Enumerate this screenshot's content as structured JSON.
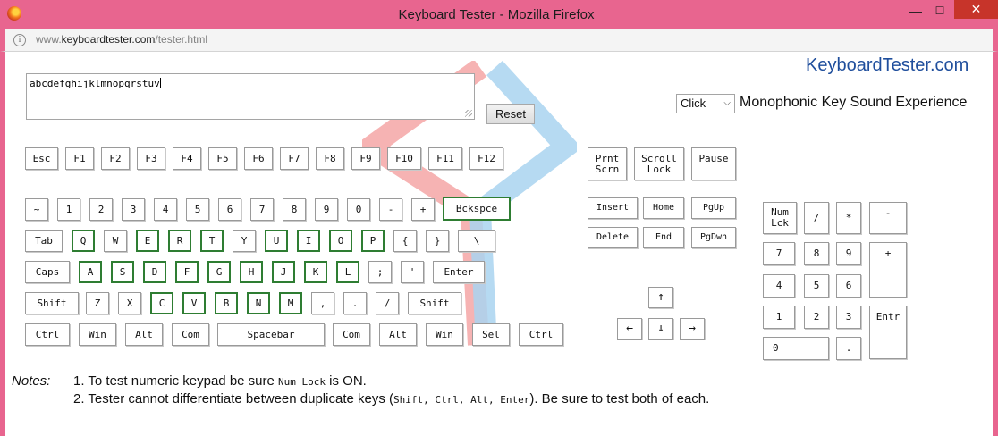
{
  "window": {
    "title": "Keyboard Tester - Mozilla Firefox",
    "minimize_glyph": "—",
    "maximize_glyph": "☐",
    "close_glyph": "✕"
  },
  "address_bar": {
    "info_glyph": "i",
    "url_prefix": "www.",
    "url_host": "keyboardtester.com",
    "url_path": "/tester.html"
  },
  "page": {
    "logo_text": "KeyboardTester.com",
    "typed_text": "abcdefghijklmnopqrstuv",
    "reset_label": "Reset",
    "sound_select_value": "Click",
    "sound_select_arrow": "⌵",
    "sound_label": "Monophonic Key Sound Experience"
  },
  "keys": {
    "fn_row": [
      {
        "label": "Esc",
        "pressed": false
      },
      {
        "label": "F1",
        "pressed": false
      },
      {
        "label": "F2",
        "pressed": false
      },
      {
        "label": "F3",
        "pressed": false
      },
      {
        "label": "F4",
        "pressed": false
      },
      {
        "label": "F5",
        "pressed": false
      },
      {
        "label": "F6",
        "pressed": false
      },
      {
        "label": "F7",
        "pressed": false
      },
      {
        "label": "F8",
        "pressed": false
      },
      {
        "label": "F9",
        "pressed": false
      },
      {
        "label": "F10",
        "pressed": false
      },
      {
        "label": "F11",
        "pressed": false
      },
      {
        "label": "F12",
        "pressed": false
      }
    ],
    "num_row": [
      {
        "label": "~",
        "pressed": false
      },
      {
        "label": "1",
        "pressed": false
      },
      {
        "label": "2",
        "pressed": false
      },
      {
        "label": "3",
        "pressed": false
      },
      {
        "label": "4",
        "pressed": false
      },
      {
        "label": "5",
        "pressed": false
      },
      {
        "label": "6",
        "pressed": false
      },
      {
        "label": "7",
        "pressed": false
      },
      {
        "label": "8",
        "pressed": false
      },
      {
        "label": "9",
        "pressed": false
      },
      {
        "label": "0",
        "pressed": false
      },
      {
        "label": "-",
        "pressed": false
      },
      {
        "label": "+",
        "pressed": false
      },
      {
        "label": "Bckspce",
        "pressed": true
      }
    ],
    "tab_row": [
      {
        "label": "Tab",
        "pressed": false
      },
      {
        "label": "Q",
        "pressed": true
      },
      {
        "label": "W",
        "pressed": false
      },
      {
        "label": "E",
        "pressed": true
      },
      {
        "label": "R",
        "pressed": true
      },
      {
        "label": "T",
        "pressed": true
      },
      {
        "label": "Y",
        "pressed": false
      },
      {
        "label": "U",
        "pressed": true
      },
      {
        "label": "I",
        "pressed": true
      },
      {
        "label": "O",
        "pressed": true
      },
      {
        "label": "P",
        "pressed": true
      },
      {
        "label": "{",
        "pressed": false
      },
      {
        "label": "}",
        "pressed": false
      },
      {
        "label": "\\",
        "pressed": false
      }
    ],
    "caps_row": [
      {
        "label": "Caps",
        "pressed": false
      },
      {
        "label": "A",
        "pressed": true
      },
      {
        "label": "S",
        "pressed": true
      },
      {
        "label": "D",
        "pressed": true
      },
      {
        "label": "F",
        "pressed": true
      },
      {
        "label": "G",
        "pressed": true
      },
      {
        "label": "H",
        "pressed": true
      },
      {
        "label": "J",
        "pressed": true
      },
      {
        "label": "K",
        "pressed": true
      },
      {
        "label": "L",
        "pressed": true
      },
      {
        "label": ";",
        "pressed": false
      },
      {
        "label": "'",
        "pressed": false
      },
      {
        "label": "Enter",
        "pressed": false
      }
    ],
    "shift_row": [
      {
        "label": "Shift",
        "pressed": false
      },
      {
        "label": "Z",
        "pressed": false
      },
      {
        "label": "X",
        "pressed": false
      },
      {
        "label": "C",
        "pressed": true
      },
      {
        "label": "V",
        "pressed": true
      },
      {
        "label": "B",
        "pressed": true
      },
      {
        "label": "N",
        "pressed": true
      },
      {
        "label": "M",
        "pressed": true
      },
      {
        "label": ",",
        "pressed": false
      },
      {
        "label": ".",
        "pressed": false
      },
      {
        "label": "/",
        "pressed": false
      },
      {
        "label": "Shift",
        "pressed": false
      }
    ],
    "bottom_row": [
      {
        "label": "Ctrl",
        "pressed": false
      },
      {
        "label": "Win",
        "pressed": false
      },
      {
        "label": "Alt",
        "pressed": false
      },
      {
        "label": "Com",
        "pressed": false
      },
      {
        "label": "Spacebar",
        "pressed": false
      },
      {
        "label": "Com",
        "pressed": false
      },
      {
        "label": "Alt",
        "pressed": false
      },
      {
        "label": "Win",
        "pressed": false
      },
      {
        "label": "Sel",
        "pressed": false
      },
      {
        "label": "Ctrl",
        "pressed": false
      }
    ],
    "system_keys": [
      {
        "label": "Prnt Scrn",
        "pressed": false
      },
      {
        "label": "Scroll Lock",
        "pressed": false
      },
      {
        "label": "Pause",
        "pressed": false
      }
    ],
    "nav_keys": [
      {
        "label": "Insert",
        "pressed": false
      },
      {
        "label": "Home",
        "pressed": false
      },
      {
        "label": "PgUp",
        "pressed": false
      },
      {
        "label": "Delete",
        "pressed": false
      },
      {
        "label": "End",
        "pressed": false
      },
      {
        "label": "PgDwn",
        "pressed": false
      }
    ],
    "arrow_keys": [
      {
        "label": "↑",
        "pressed": false
      },
      {
        "label": "←",
        "pressed": false
      },
      {
        "label": "↓",
        "pressed": false
      },
      {
        "label": "→",
        "pressed": false
      }
    ],
    "numpad": [
      {
        "label": "Num Lck",
        "pressed": false
      },
      {
        "label": "/",
        "pressed": false
      },
      {
        "label": "*",
        "pressed": false
      },
      {
        "label": "-",
        "pressed": false
      },
      {
        "label": "7",
        "pressed": false
      },
      {
        "label": "8",
        "pressed": false
      },
      {
        "label": "9",
        "pressed": false
      },
      {
        "label": "+",
        "pressed": false
      },
      {
        "label": "4",
        "pressed": false
      },
      {
        "label": "5",
        "pressed": false
      },
      {
        "label": "6",
        "pressed": false
      },
      {
        "label": "1",
        "pressed": false
      },
      {
        "label": "2",
        "pressed": false
      },
      {
        "label": "3",
        "pressed": false
      },
      {
        "label": "Entr",
        "pressed": false
      },
      {
        "label": "0",
        "pressed": false
      },
      {
        "label": ".",
        "pressed": false
      }
    ]
  },
  "notes": {
    "label": "Notes:",
    "note1_pre": "1. To test numeric keypad be sure ",
    "note1_code": "Num Lock",
    "note1_post": " is ON.",
    "note2_pre": "2. Tester cannot differentiate between duplicate keys (",
    "note2_code": "Shift, Ctrl, Alt, Enter",
    "note2_post": "). Be sure to test both of each."
  },
  "colors": {
    "title_bar": "#e8658f",
    "close_button": "#c7342a",
    "logo_text": "#1f4e9c",
    "pressed_key_border": "#2e7d32",
    "watermark_left": "#f4a6a6",
    "watermark_right": "#a9d4f0"
  }
}
